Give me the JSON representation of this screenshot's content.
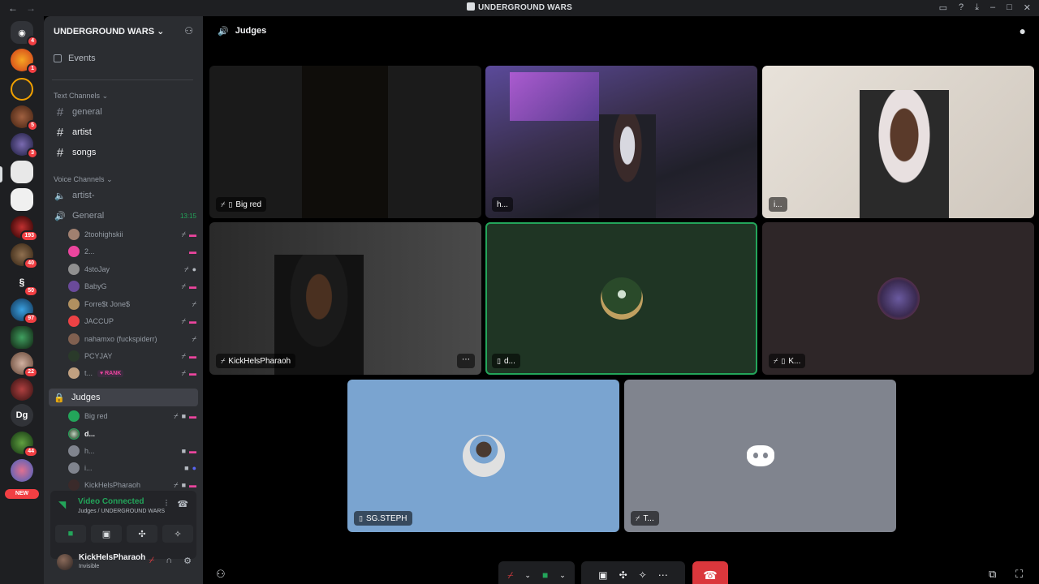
{
  "window": {
    "title": "UNDERGROUND WARS"
  },
  "server": {
    "name": "UNDERGROUND WARS",
    "events_label": "Events",
    "text_category": "Text Channels",
    "text_channels": [
      {
        "name": "general"
      },
      {
        "name": "artist"
      },
      {
        "name": "songs"
      }
    ],
    "voice_category": "Voice Channels",
    "voice_channels": [
      {
        "name": "artist-"
      },
      {
        "name": "General",
        "time": "13:15"
      },
      {
        "name": "Judges"
      }
    ],
    "general_users": [
      {
        "name": "2toohighskii"
      },
      {
        "name": "2..."
      },
      {
        "name": "4stoJay"
      },
      {
        "name": "BabyG"
      },
      {
        "name": "Forre$t Jone$"
      },
      {
        "name": "JACCUP"
      },
      {
        "name": "nahamxo (fuckspiderr)"
      },
      {
        "name": "PCYJAY"
      },
      {
        "name": "t...",
        "tag": "RANK"
      }
    ],
    "judges_users": [
      {
        "name": "Big red"
      },
      {
        "name": "d..."
      },
      {
        "name": "h..."
      },
      {
        "name": "i..."
      },
      {
        "name": "KickHelsPharaoh"
      }
    ]
  },
  "rail": {
    "badges": [
      "4",
      "1",
      "5",
      "3",
      "193",
      "40",
      "50",
      "97",
      "22",
      "44"
    ],
    "text_server": "Dg",
    "new_label": "NEW"
  },
  "voice_panel": {
    "status": "Video Connected",
    "location": "Judges / UNDERGROUND WARS"
  },
  "user_panel": {
    "name": "KickHelsPharaoh",
    "status": "Invisible"
  },
  "main": {
    "channel_title": "Judges",
    "tiles": [
      {
        "label": "Big red"
      },
      {
        "label": "h..."
      },
      {
        "label": "i..."
      },
      {
        "label": "KickHelsPharaoh"
      },
      {
        "label": "d..."
      },
      {
        "label": "K..."
      },
      {
        "label": "SG.STEPH"
      },
      {
        "label": "T..."
      }
    ]
  },
  "icons": {
    "mic_muted": "mic-muted-icon",
    "camera": "camera-icon",
    "screen_share": "screen-share-icon",
    "activities": "activities-icon",
    "soundboard": "soundboard-icon",
    "more": "more-icon",
    "hang_up": "hang-up-icon"
  },
  "colors": {
    "accent_green": "#23a55a",
    "danger_red": "#da373c",
    "discord_blurple": "#5865f2",
    "pink": "#eb459e"
  }
}
